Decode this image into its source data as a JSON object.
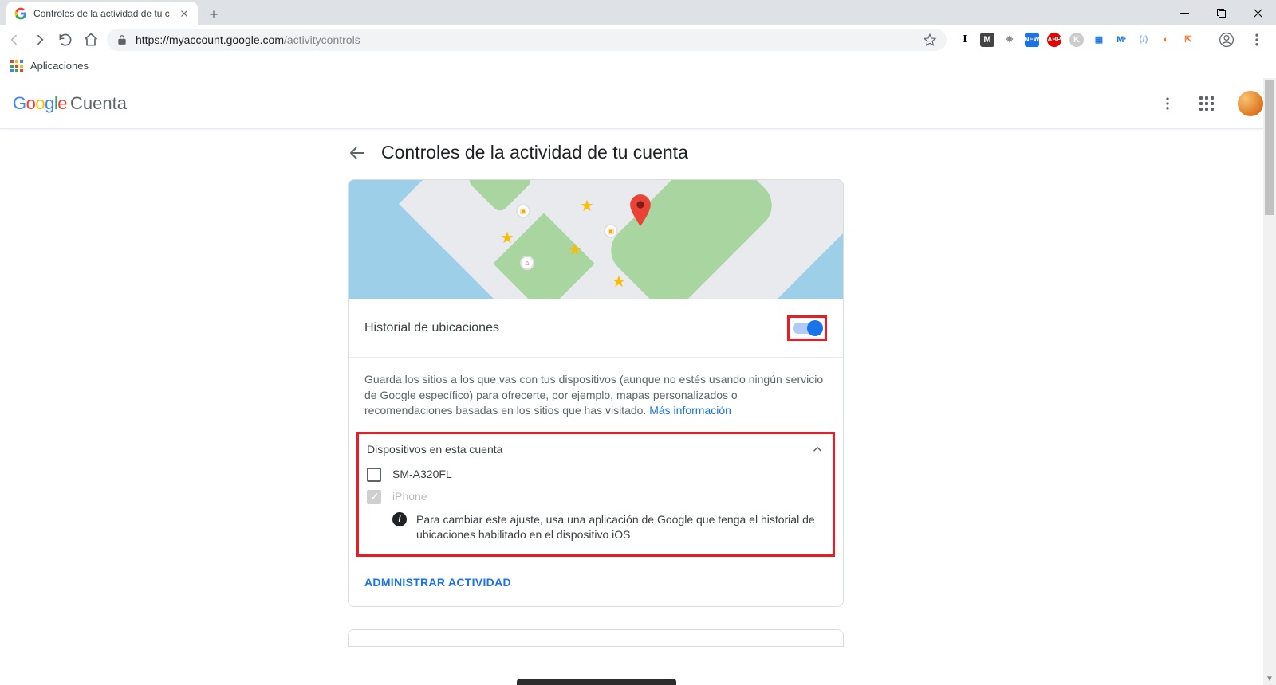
{
  "browser": {
    "tab_title": "Controles de la actividad de tu c",
    "url_host": "https://myaccount.google.com",
    "url_path": "/activitycontrols",
    "bookmarks_label": "Aplicaciones"
  },
  "header": {
    "logo_suffix": "Cuenta"
  },
  "page": {
    "title": "Controles de la actividad de tu cuenta"
  },
  "card": {
    "title": "Historial de ubicaciones",
    "toggle_on": true,
    "description": "Guarda los sitios a los que vas con tus dispositivos (aunque no estés usando ningún servicio de Google específico) para ofrecerte, por ejemplo, mapas personalizados o recomendaciones basadas en los sitios que has visitado. ",
    "more_info": "Más información",
    "devices_header": "Dispositivos en esta cuenta",
    "devices": [
      {
        "name": "SM-A320FL",
        "checked": false,
        "disabled": false
      },
      {
        "name": "iPhone",
        "checked": true,
        "disabled": true
      }
    ],
    "device_info": "Para cambiar este ajuste, usa una aplicación de Google que tenga el historial de ubicaciones habilitado en el dispositivo iOS",
    "manage_label": "ADMINISTRAR ACTIVIDAD"
  }
}
